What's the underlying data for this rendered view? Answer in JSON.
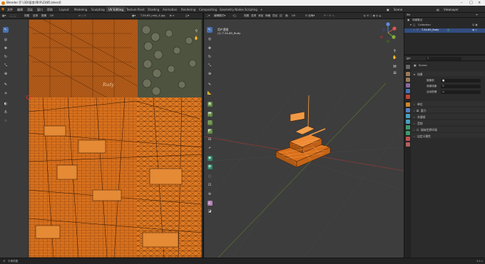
{
  "window": {
    "title": "Blender [F:\\3D\\宿舍\\草坪\\Z485.blend]"
  },
  "menu": {
    "items": [
      "文件",
      "编辑",
      "渲染",
      "窗口",
      "帮助"
    ]
  },
  "workspaces": {
    "tabs": [
      "Layout",
      "Modeling",
      "Sculpting",
      "UV Editing",
      "Texture Paint",
      "Shading",
      "Animation",
      "Rendering",
      "Compositing",
      "Geometry Nodes",
      "Scripting",
      "+"
    ],
    "active": "UV Editing"
  },
  "topright": {
    "scene": "Scene",
    "view_layer": "ViewLayer"
  },
  "uv_editor": {
    "header": {
      "mode": "UV",
      "view": "视图",
      "select": "选择",
      "image": "图像",
      "uv": "UV",
      "image_name": "T-34-85_rudy_4.jpg"
    },
    "texture_label": "Rudy"
  },
  "viewport": {
    "header": {
      "mode": "编辑模式",
      "view": "视图",
      "select": "选择",
      "add": "添加",
      "mesh": "网格",
      "vertex": "顶点",
      "edge": "边",
      "face": "面",
      "uv": "UV",
      "transform": "全局"
    },
    "overlay_title": "用户透视",
    "overlay_object": "(1) T-34-85_Rudy"
  },
  "outliner": {
    "title": "场景集合",
    "collection": "Collection",
    "object": "T-34-85_Rudy"
  },
  "properties": {
    "search_placeholder": "",
    "scene_name": "Scene",
    "sections": {
      "scene_header": "场景",
      "camera_label": "摄像机",
      "background_scene_label": "背景场景",
      "active_clip_label": "活动剪辑",
      "units": "单位",
      "gravity": "重力",
      "keying_sets": "关键帧",
      "audio": "音频",
      "rigid_body_world": "刚体世界环境",
      "custom_properties": "自定义属性"
    }
  },
  "status_bar": {
    "left": "平移视图",
    "version": "3.4.1"
  },
  "colors": {
    "accent": "#4772b3",
    "uv_orange": "#e87a1f",
    "wire_orange": "#f39a3a"
  }
}
